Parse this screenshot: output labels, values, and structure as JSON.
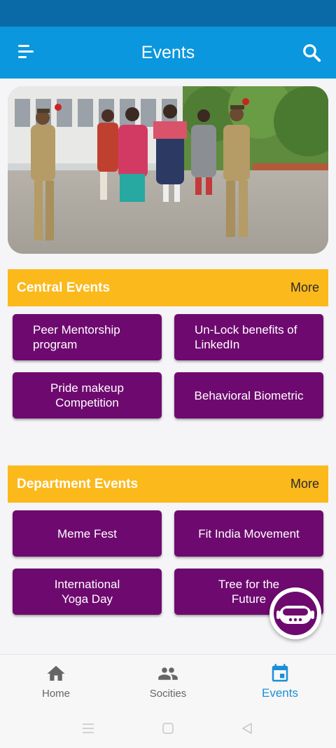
{
  "app_bar": {
    "title": "Events"
  },
  "sections": [
    {
      "title": "Central Events",
      "more": "More",
      "events": [
        "Peer Mentorship\nprogram",
        "Un-Lock benefits of\nLinkedIn",
        "Pride makeup\nCompetition",
        "Behavioral Biometric"
      ]
    },
    {
      "title": "Department Events",
      "more": "More",
      "events": [
        "Meme Fest",
        "Fit India Movement",
        "International\nYoga Day",
        "Tree for the\nFuture"
      ]
    }
  ],
  "bottom_nav": [
    {
      "label": "Home",
      "icon": "home-icon"
    },
    {
      "label": "Socities",
      "icon": "people-icon"
    },
    {
      "label": "Events",
      "icon": "calendar-icon",
      "active": true
    }
  ],
  "colors": {
    "app_bar": "#0b97dd",
    "status_bar": "#0a6aa8",
    "section_header": "#fbb91c",
    "event_card": "#6e0a6f",
    "active_nav": "#1a8fd8"
  }
}
